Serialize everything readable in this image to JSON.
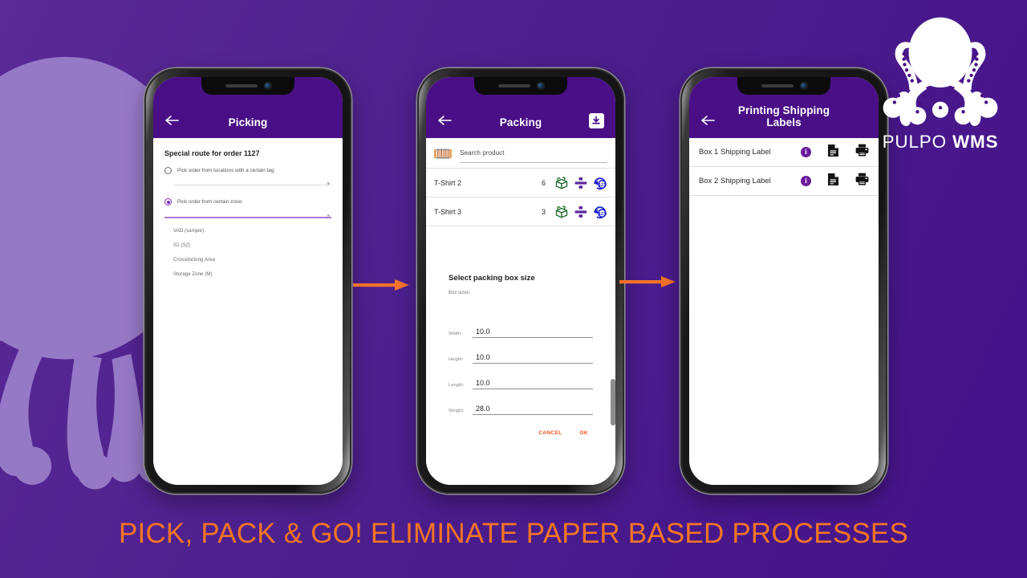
{
  "brand": {
    "name_light": "PULPO",
    "name_bold": "WMS",
    "logo_icon": "octopus-logo-icon",
    "accent_orange": "#f47425",
    "purple_bg": "#4b1f8c",
    "appbar_purple": "#4a0f86"
  },
  "headline": "PICK, PACK & GO! ELIMINATE PAPER BASED PROCESSES",
  "arrows": [
    {
      "name": "arrow-phone1-to-phone2",
      "icon": "arrow-right-icon"
    },
    {
      "name": "arrow-phone2-to-phone3",
      "icon": "arrow-right-icon"
    }
  ],
  "phones": [
    {
      "id": "picking",
      "appbar": {
        "back_icon": "back-arrow-icon",
        "title": "Picking"
      },
      "heading": "Special route for order 1127",
      "options": [
        {
          "label": "Pick order from locations with a certain tag:",
          "selected": false
        },
        {
          "label": "Pick order from certain zone:",
          "selected": true
        }
      ],
      "zones": [
        "VAD (sample)",
        "S2 (S2)",
        "Crossdocking Area",
        "Storage Zone (M)"
      ]
    },
    {
      "id": "packing",
      "appbar": {
        "back_icon": "back-arrow-icon",
        "title": "Packing",
        "trailing_icon": "download-box-icon"
      },
      "search": {
        "scan_icon": "barcode-scan-icon",
        "placeholder": "Search product",
        "value": ""
      },
      "products": [
        {
          "name": "T-Shirt 2",
          "qty": "6",
          "actions": [
            "open-box-icon",
            "divide-icon",
            "renumber-123-icon"
          ]
        },
        {
          "name": "T-Shirt 3",
          "qty": "3",
          "actions": [
            "open-box-icon",
            "divide-icon",
            "renumber-123-icon"
          ]
        }
      ],
      "dialog": {
        "title": "Select packing box size",
        "sub_label": "Box sizes:",
        "fields": [
          {
            "label": "Width:",
            "value": "10.0"
          },
          {
            "label": "Height:",
            "value": "10.0"
          },
          {
            "label": "Length:",
            "value": "10.0"
          },
          {
            "label": "Weight:",
            "value": "28.0"
          }
        ],
        "cancel_label": "CANCEL",
        "ok_label": "OK"
      }
    },
    {
      "id": "printing",
      "appbar": {
        "back_icon": "back-arrow-icon",
        "title": "Printing Shipping Labels"
      },
      "labels": [
        {
          "name": "Box  1 Shipping Label",
          "icons": [
            "info-icon",
            "document-icon",
            "printer-icon"
          ]
        },
        {
          "name": "Box  2 Shipping Label",
          "icons": [
            "info-icon",
            "document-icon",
            "printer-icon"
          ]
        }
      ]
    }
  ]
}
